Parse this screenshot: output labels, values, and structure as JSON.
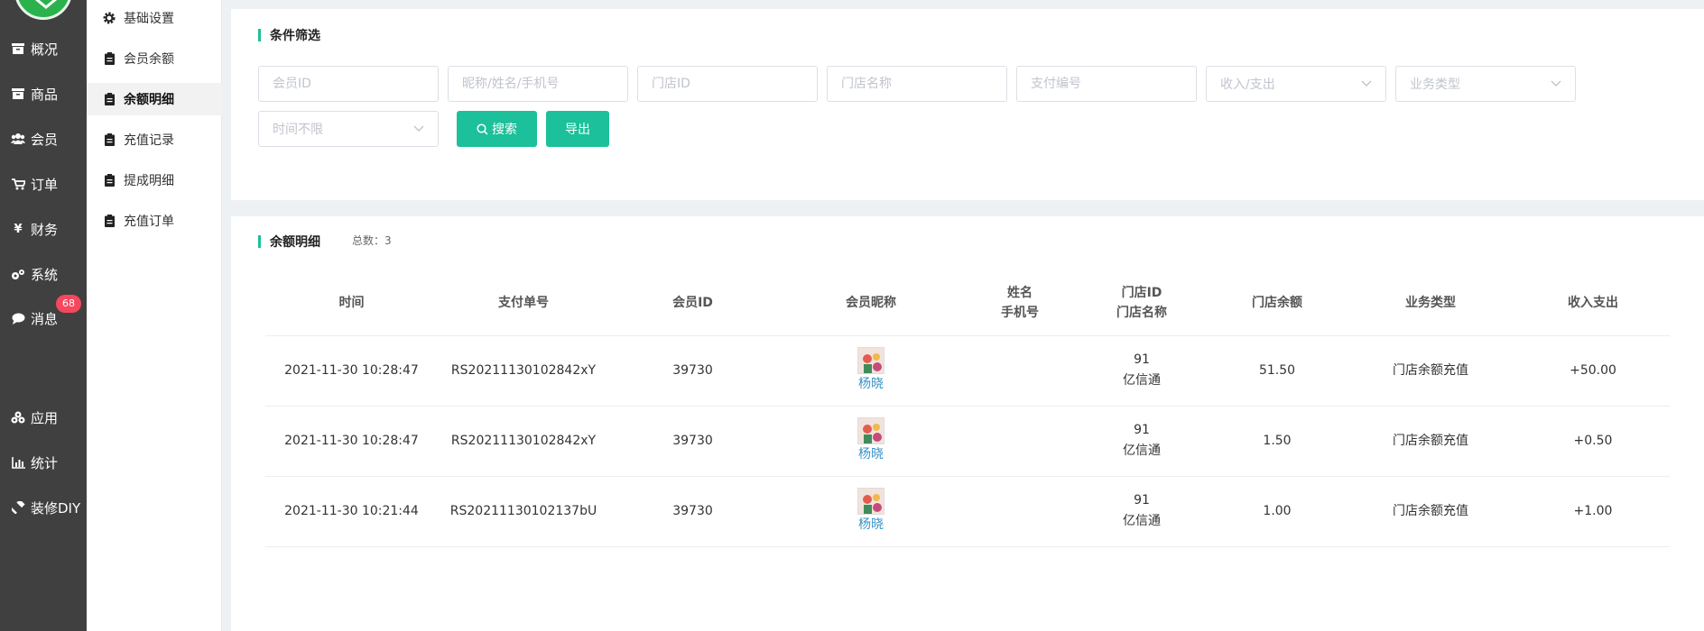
{
  "nav": [
    {
      "label": "概况",
      "icon": "overview-icon"
    },
    {
      "label": "商品",
      "icon": "goods-icon"
    },
    {
      "label": "会员",
      "icon": "members-icon"
    },
    {
      "label": "订单",
      "icon": "cart-icon"
    },
    {
      "label": "财务",
      "icon": "yen-icon"
    },
    {
      "label": "系统",
      "icon": "gears-icon"
    },
    {
      "label": "消息",
      "icon": "message-icon"
    },
    {
      "label": "应用",
      "icon": "apps-icon"
    },
    {
      "label": "统计",
      "icon": "chart-icon"
    },
    {
      "label": "装修DIY",
      "icon": "hammer-icon"
    }
  ],
  "message_badge": "68",
  "submenu": [
    {
      "label": "基础设置",
      "icon": "gear-icon"
    },
    {
      "label": "会员余额",
      "icon": "clipboard-icon"
    },
    {
      "label": "余额明细",
      "icon": "clipboard-icon",
      "active": true
    },
    {
      "label": "充值记录",
      "icon": "clipboard-icon"
    },
    {
      "label": "提成明细",
      "icon": "clipboard-icon"
    },
    {
      "label": "充值订单",
      "icon": "clipboard-icon"
    }
  ],
  "filter": {
    "title": "条件筛选",
    "placeholders": {
      "member_id": "会员ID",
      "nickname": "昵称/姓名/手机号",
      "store_id": "门店ID",
      "store_name": "门店名称",
      "pay_no": "支付编号",
      "in_out": "收入/支出",
      "biz_type": "业务类型",
      "time": "时间不限"
    },
    "search_label": "搜索",
    "export_label": "导出"
  },
  "detail": {
    "title": "余额明细",
    "total": "总数：3",
    "headers": {
      "time": "时间",
      "pay_no": "支付单号",
      "member_id": "会员ID",
      "nickname": "会员昵称",
      "name": "姓名",
      "phone": "手机号",
      "store_id": "门店ID",
      "store_name": "门店名称",
      "balance": "门店余额",
      "biz_type": "业务类型",
      "in_out": "收入支出"
    },
    "rows": [
      {
        "time": "2021-11-30 10:28:47",
        "pay_no": "RS20211130102842xY",
        "member_id": "39730",
        "nickname": "杨晓",
        "store_id": "91",
        "store_name": "亿信通",
        "balance": "51.50",
        "biz_type": "门店余额充值",
        "amount": "+50.00"
      },
      {
        "time": "2021-11-30 10:28:47",
        "pay_no": "RS20211130102842xY",
        "member_id": "39730",
        "nickname": "杨晓",
        "store_id": "91",
        "store_name": "亿信通",
        "balance": "1.50",
        "biz_type": "门店余额充值",
        "amount": "+0.50"
      },
      {
        "time": "2021-11-30 10:21:44",
        "pay_no": "RS20211130102137bU",
        "member_id": "39730",
        "nickname": "杨晓",
        "store_id": "91",
        "store_name": "亿信通",
        "balance": "1.00",
        "biz_type": "门店余额充值",
        "amount": "+1.00"
      }
    ]
  },
  "colors": {
    "accent": "#1cc09a",
    "sidebar": "#404040",
    "badge": "#f5475e",
    "link": "#3a93c8"
  }
}
